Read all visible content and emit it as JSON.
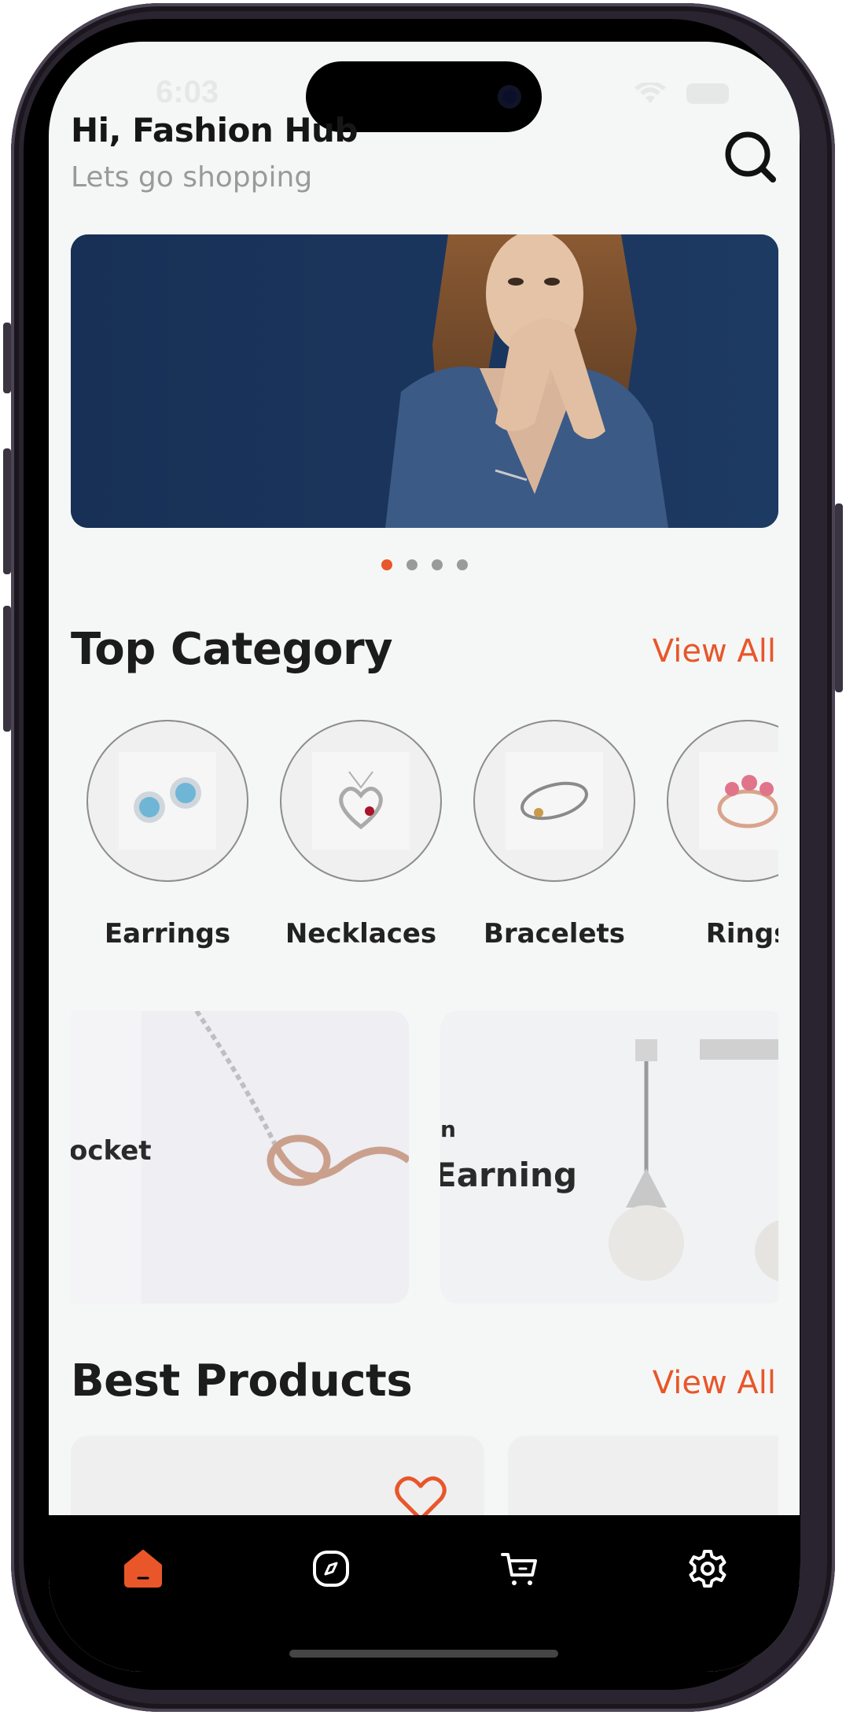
{
  "status_bar": {
    "time": "6:03"
  },
  "header": {
    "greeting": "Hi, Fashion Hub",
    "subtitle": "Lets go shopping",
    "search_icon": "search-icon"
  },
  "banner": {
    "background_color": "#1a3358",
    "slide_count": 4,
    "active_slide": 1
  },
  "top_category": {
    "title": "Top Category",
    "view_all": "View All",
    "items": [
      {
        "label": "Earrings",
        "icon": "earrings-icon"
      },
      {
        "label": "Necklaces",
        "icon": "necklace-icon"
      },
      {
        "label": "Bracelets",
        "icon": "bracelet-icon"
      },
      {
        "label": "Rings",
        "icon": "ring-icon"
      }
    ]
  },
  "promos": [
    {
      "text": "ocket"
    },
    {
      "text_small": "n",
      "text": "Earning"
    }
  ],
  "best_products": {
    "title": "Best Products",
    "view_all": "View All"
  },
  "tab_bar": {
    "items": [
      {
        "icon": "home-icon",
        "active": true
      },
      {
        "icon": "compass-icon",
        "active": false
      },
      {
        "icon": "cart-icon",
        "active": false
      },
      {
        "icon": "gear-icon",
        "active": false
      }
    ]
  },
  "colors": {
    "accent": "#e8562a",
    "background": "#f5f7f6",
    "text": "#1c1c1c",
    "muted": "#9a9a9a"
  }
}
